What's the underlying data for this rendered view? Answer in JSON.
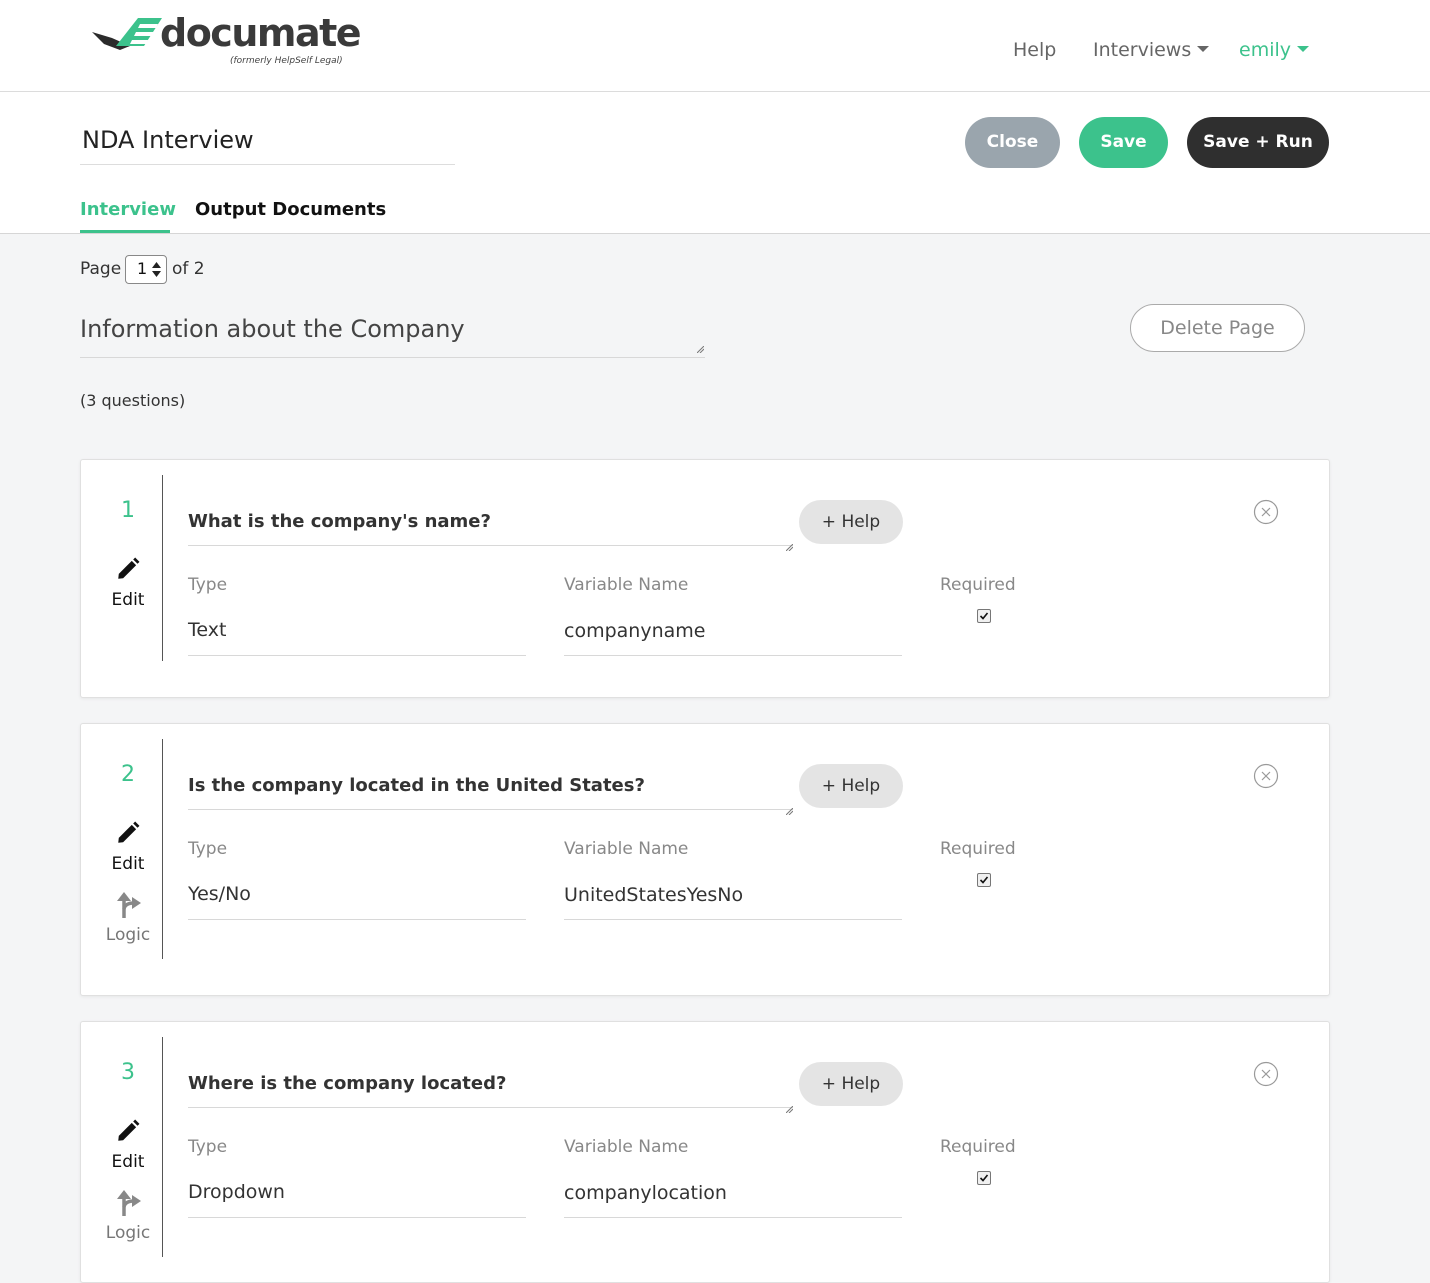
{
  "brand": {
    "name": "documate",
    "subtitle": "(formerly HelpSelf Legal)",
    "accent_color": "#3cc28c"
  },
  "nav": {
    "help": "Help",
    "interviews": "Interviews",
    "user": "emily"
  },
  "interview": {
    "title": "NDA Interview"
  },
  "actions": {
    "close": "Close",
    "save": "Save",
    "save_run": "Save + Run"
  },
  "tabs": [
    {
      "label": "Interview",
      "active": true
    },
    {
      "label": "Output Documents",
      "active": false
    }
  ],
  "pagination": {
    "label_page": "Page",
    "current": "1",
    "label_of": "of 2"
  },
  "page": {
    "title": "Information about the Company",
    "delete_label": "Delete Page",
    "question_count": "(3 questions)"
  },
  "field_labels": {
    "type": "Type",
    "variable": "Variable Name",
    "required": "Required"
  },
  "actions_labels": {
    "edit": "Edit",
    "logic": "Logic",
    "help": "+ Help"
  },
  "questions": [
    {
      "number": "1",
      "text": "What is the company's name?",
      "type": "Text",
      "variable": "companyname",
      "required": true,
      "has_logic": false
    },
    {
      "number": "2",
      "text": "Is the company located in the United States?",
      "type": "Yes/No",
      "variable": "UnitedStatesYesNo",
      "required": true,
      "has_logic": true
    },
    {
      "number": "3",
      "text": "Where is the company located?",
      "type": "Dropdown",
      "variable": "companylocation",
      "required": true,
      "has_logic": true
    }
  ]
}
